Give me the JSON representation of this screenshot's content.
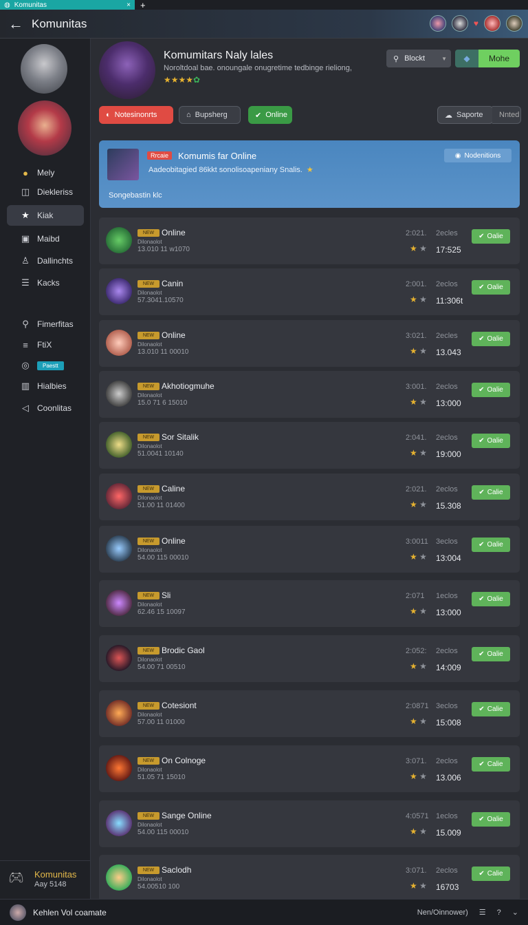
{
  "browser": {
    "tab_title": "Komunitas",
    "close_glyph": "×",
    "new_tab_glyph": "+"
  },
  "header": {
    "title": "Komunitas",
    "back_glyph": "←"
  },
  "sidebar": {
    "items": [
      {
        "label": "Mely",
        "icon": "coin-icon",
        "glyph": "●"
      },
      {
        "label": "Diekleriss",
        "icon": "gift-icon",
        "glyph": "◫"
      },
      {
        "label": "Kiak",
        "icon": "star-icon",
        "glyph": "★",
        "active": true
      },
      {
        "label": "Maibd",
        "icon": "box-icon",
        "glyph": "▣"
      },
      {
        "label": "Dallinchts",
        "icon": "user-icon",
        "glyph": "♙"
      },
      {
        "label": "Kacks",
        "icon": "list-icon",
        "glyph": "☰"
      },
      {
        "label": "Fimerfitas",
        "icon": "people-icon",
        "glyph": "⚲"
      },
      {
        "label": "FtiX",
        "icon": "settings-icon",
        "glyph": "≡"
      },
      {
        "label": "Paestt",
        "icon": "eye-icon",
        "glyph": "◎",
        "badge": true
      },
      {
        "label": "Hialbies",
        "icon": "chart-icon",
        "glyph": "▥"
      },
      {
        "label": "Coonlitas",
        "icon": "share-icon",
        "glyph": "◁"
      }
    ],
    "bottom": {
      "title": "Komunitas",
      "subtitle": "Aay 5148"
    }
  },
  "profile": {
    "title": "Komumitars Naly lales",
    "subtitle": "Noroltdoal bae. onoungale onugretime tedbinge rieliong,",
    "block_label": "Blockt",
    "more_label": "Mohe",
    "stars": "★★★★"
  },
  "pills": {
    "notifications": "Notesinonrts",
    "bupsherg": "Bupsherg",
    "online": "Online",
    "saporte": "Saporte",
    "noted": "Nnted"
  },
  "banner": {
    "tag": "Rrcaie",
    "title": "Komumis far Online",
    "subtitle": "Aadeobitagied 86kkt sonolisoapeniany Snalis.",
    "button": "Nodenitions",
    "bottom": "Songebastin klc"
  },
  "rows": [
    {
      "name": "Online",
      "l2": "Dilonaolot",
      "l3": "13.010 11 w1070",
      "time": "2:021.",
      "unit": "2ecles",
      "value": "17:525",
      "btn": "Oalie"
    },
    {
      "name": "Canin",
      "l2": "Dilonaolot",
      "l3": "57.3041.10570",
      "time": "2:001.",
      "unit": "2eclos",
      "value": "11:306t",
      "btn": "Oalie"
    },
    {
      "name": "Online",
      "l2": "Dilonaolot",
      "l3": "13.010 11 00010",
      "time": "3:021.",
      "unit": "2ecles",
      "value": "13.043",
      "btn": "Oalie"
    },
    {
      "name": "Akhotiogmuhe",
      "l2": "Dilonaolot",
      "l3": "15.0 71 6 15010",
      "time": "3:001.",
      "unit": "2eclos",
      "value": "13:000",
      "btn": "Oalie"
    },
    {
      "name": "Sor Sitalik",
      "l2": "Dilonaolot",
      "l3": "51.0041 10140",
      "time": "2:041.",
      "unit": "2eclos",
      "value": "19:000",
      "btn": "Oalie"
    },
    {
      "name": "Caline",
      "l2": "Dilonaolot",
      "l3": "51.00 11 01400",
      "time": "2:021.",
      "unit": "2eclos",
      "value": "15.308",
      "btn": "Calie"
    },
    {
      "name": "Online",
      "l2": "Dilonaolot",
      "l3": "54.00 115 00010",
      "time": "3:0011",
      "unit": "3eclos",
      "value": "13:004",
      "btn": "Oalie"
    },
    {
      "name": "Sli",
      "l2": "Dilonaolot",
      "l3": "62.46 15 10097",
      "time": "2:071",
      "unit": "1eclos",
      "value": "13:000",
      "btn": "Oalie"
    },
    {
      "name": "Brodic Gaol",
      "l2": "Dilonaolot",
      "l3": "54.00 71 00510",
      "time": "2:052:",
      "unit": "2eclos",
      "value": "14:009",
      "btn": "Oalie"
    },
    {
      "name": "Cotesiont",
      "l2": "Dilonaolot",
      "l3": "57.00 11 01000",
      "time": "2:0871",
      "unit": "3eclos",
      "value": "15:008",
      "btn": "Calie"
    },
    {
      "name": "On Colnoge",
      "l2": "Dilonaolot",
      "l3": "51.05 71 15010",
      "time": "3:071.",
      "unit": "2eclos",
      "value": "13.006",
      "btn": "Calie"
    },
    {
      "name": "Sange Online",
      "l2": "Dilonaolot",
      "l3": "54.00 115 00010",
      "time": "4:0571",
      "unit": "1eclos",
      "value": "15.009",
      "btn": "Oalie"
    },
    {
      "name": "Saclodh",
      "l2": "Dilonaolot",
      "l3": "54.00510 100",
      "time": "3:071.",
      "unit": "2eclos",
      "value": "16703",
      "btn": "Calie"
    }
  ],
  "row_tag": "NEW",
  "footer": {
    "name": "Kehlen Vol coamate",
    "right": "Nen/Oinnower)"
  },
  "colors": {
    "accent": "#5fb35a",
    "banner": "#4a86bf",
    "danger": "#e04b43",
    "gold": "#e6b230"
  }
}
